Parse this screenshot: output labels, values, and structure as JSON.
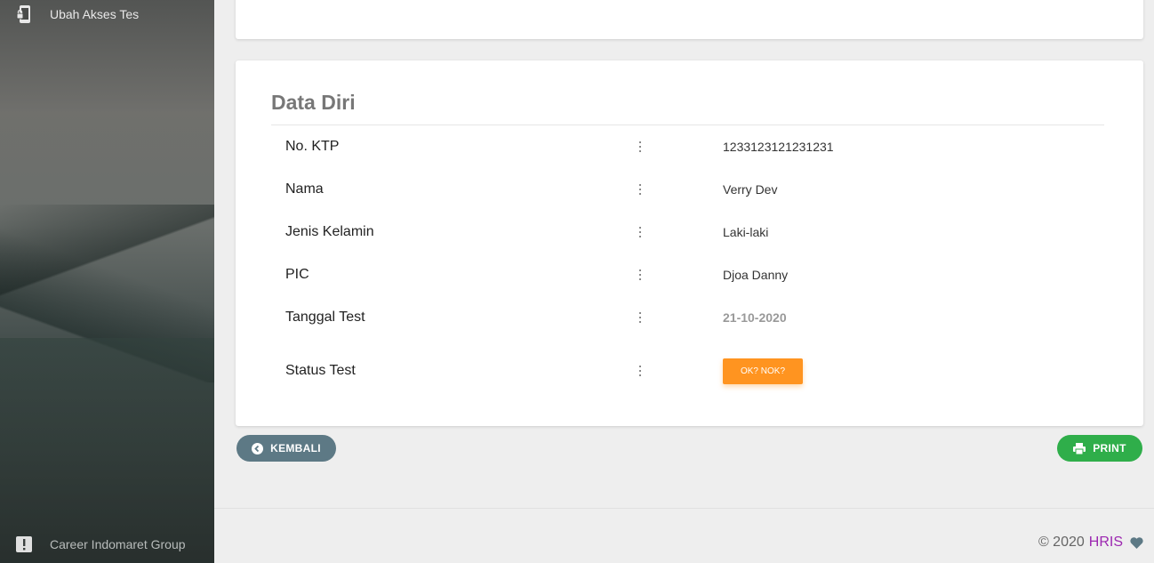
{
  "sidebar": {
    "top_item": {
      "label": "Ubah Akses Tes",
      "icon": "mobile-lock-icon"
    },
    "bottom_item": {
      "label": "Career Indomaret Group",
      "icon": "alert-icon"
    }
  },
  "card": {
    "title": "Data Diri",
    "rows": [
      {
        "label": "No. KTP",
        "value": "1233123121231231"
      },
      {
        "label": "Nama",
        "value": "Verry Dev"
      },
      {
        "label": "Jenis Kelamin",
        "value": "Laki-laki"
      },
      {
        "label": "PIC",
        "value": "Djoa Danny"
      },
      {
        "label": "Tanggal Test",
        "value": "21-10-2020"
      },
      {
        "label": "Status Test",
        "value": "OK? NOK?"
      }
    ]
  },
  "buttons": {
    "back_label": "KEMBALI",
    "print_label": "PRINT"
  },
  "footer": {
    "copyright": "© 2020",
    "brand": "HRIS"
  },
  "colors": {
    "status_button": "#ff9420",
    "back_button": "#5d7985",
    "print_button": "#2fae4a",
    "brand": "#9c27b0"
  }
}
